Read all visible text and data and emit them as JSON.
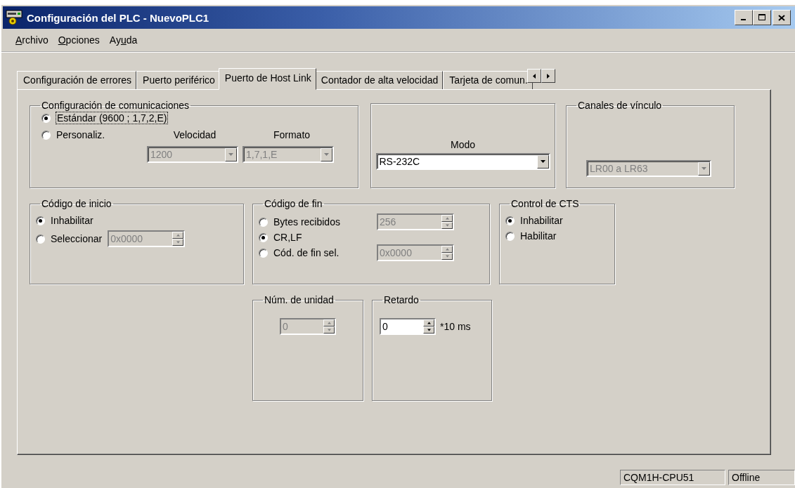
{
  "window": {
    "title": "Configuración del PLC - NuevoPLC1"
  },
  "menu": [
    {
      "key": "A",
      "after": "rchivo"
    },
    {
      "key": "O",
      "after": "pciones"
    },
    {
      "key": "u",
      "before": "Ay",
      "after": "da"
    }
  ],
  "tabs": [
    {
      "label": "Configuración de errores",
      "selected": false
    },
    {
      "label": "Puerto periférico",
      "selected": false
    },
    {
      "label": "Puerto de Host Link",
      "selected": true
    },
    {
      "label": "Contador de alta velocidad",
      "selected": false
    },
    {
      "label": "Tarjeta de comun.",
      "selected": false
    }
  ],
  "communications": {
    "title": "Configuración de comunicaciones",
    "options": [
      {
        "label": "Estándar (9600 ; 1,7,2,E)",
        "selected": true,
        "focused": true
      },
      {
        "label": "Personaliz.",
        "selected": false,
        "focused": false
      }
    ],
    "speed": {
      "label": "Velocidad",
      "value": "1200",
      "disabled": true
    },
    "format": {
      "label": "Formato",
      "value": "1,7,1,E",
      "disabled": true
    }
  },
  "mode": {
    "label": "Modo",
    "value": "RS-232C",
    "disabled": false
  },
  "link_channels": {
    "title": "Canales de vínculo",
    "value": "LR00 a LR63",
    "disabled": true
  },
  "start_code": {
    "title": "Código de inicio",
    "options": [
      {
        "label": "Inhabilitar",
        "selected": true
      },
      {
        "label": "Seleccionar",
        "selected": false,
        "field": {
          "value": "0x0000",
          "disabled": true
        }
      }
    ]
  },
  "end_code": {
    "title": "Código de fin",
    "options": [
      {
        "label": "Bytes recibidos",
        "selected": false,
        "field": {
          "value": "256",
          "disabled": true
        }
      },
      {
        "label": "CR,LF",
        "selected": true
      },
      {
        "label": "Cód. de fin sel.",
        "selected": false,
        "field": {
          "value": "0x0000",
          "disabled": true
        }
      }
    ]
  },
  "cts_control": {
    "title": "Control de CTS",
    "options": [
      {
        "label": "Inhabilitar",
        "selected": true
      },
      {
        "label": "Habilitar",
        "selected": false
      }
    ]
  },
  "unit_number": {
    "title": "Núm. de unidad",
    "value": "0",
    "disabled": true
  },
  "delay": {
    "title": "Retardo",
    "value": "0",
    "disabled": false,
    "unit": "*10 ms"
  },
  "status_bar": [
    "CQM1H-CPU51",
    "Offline"
  ]
}
